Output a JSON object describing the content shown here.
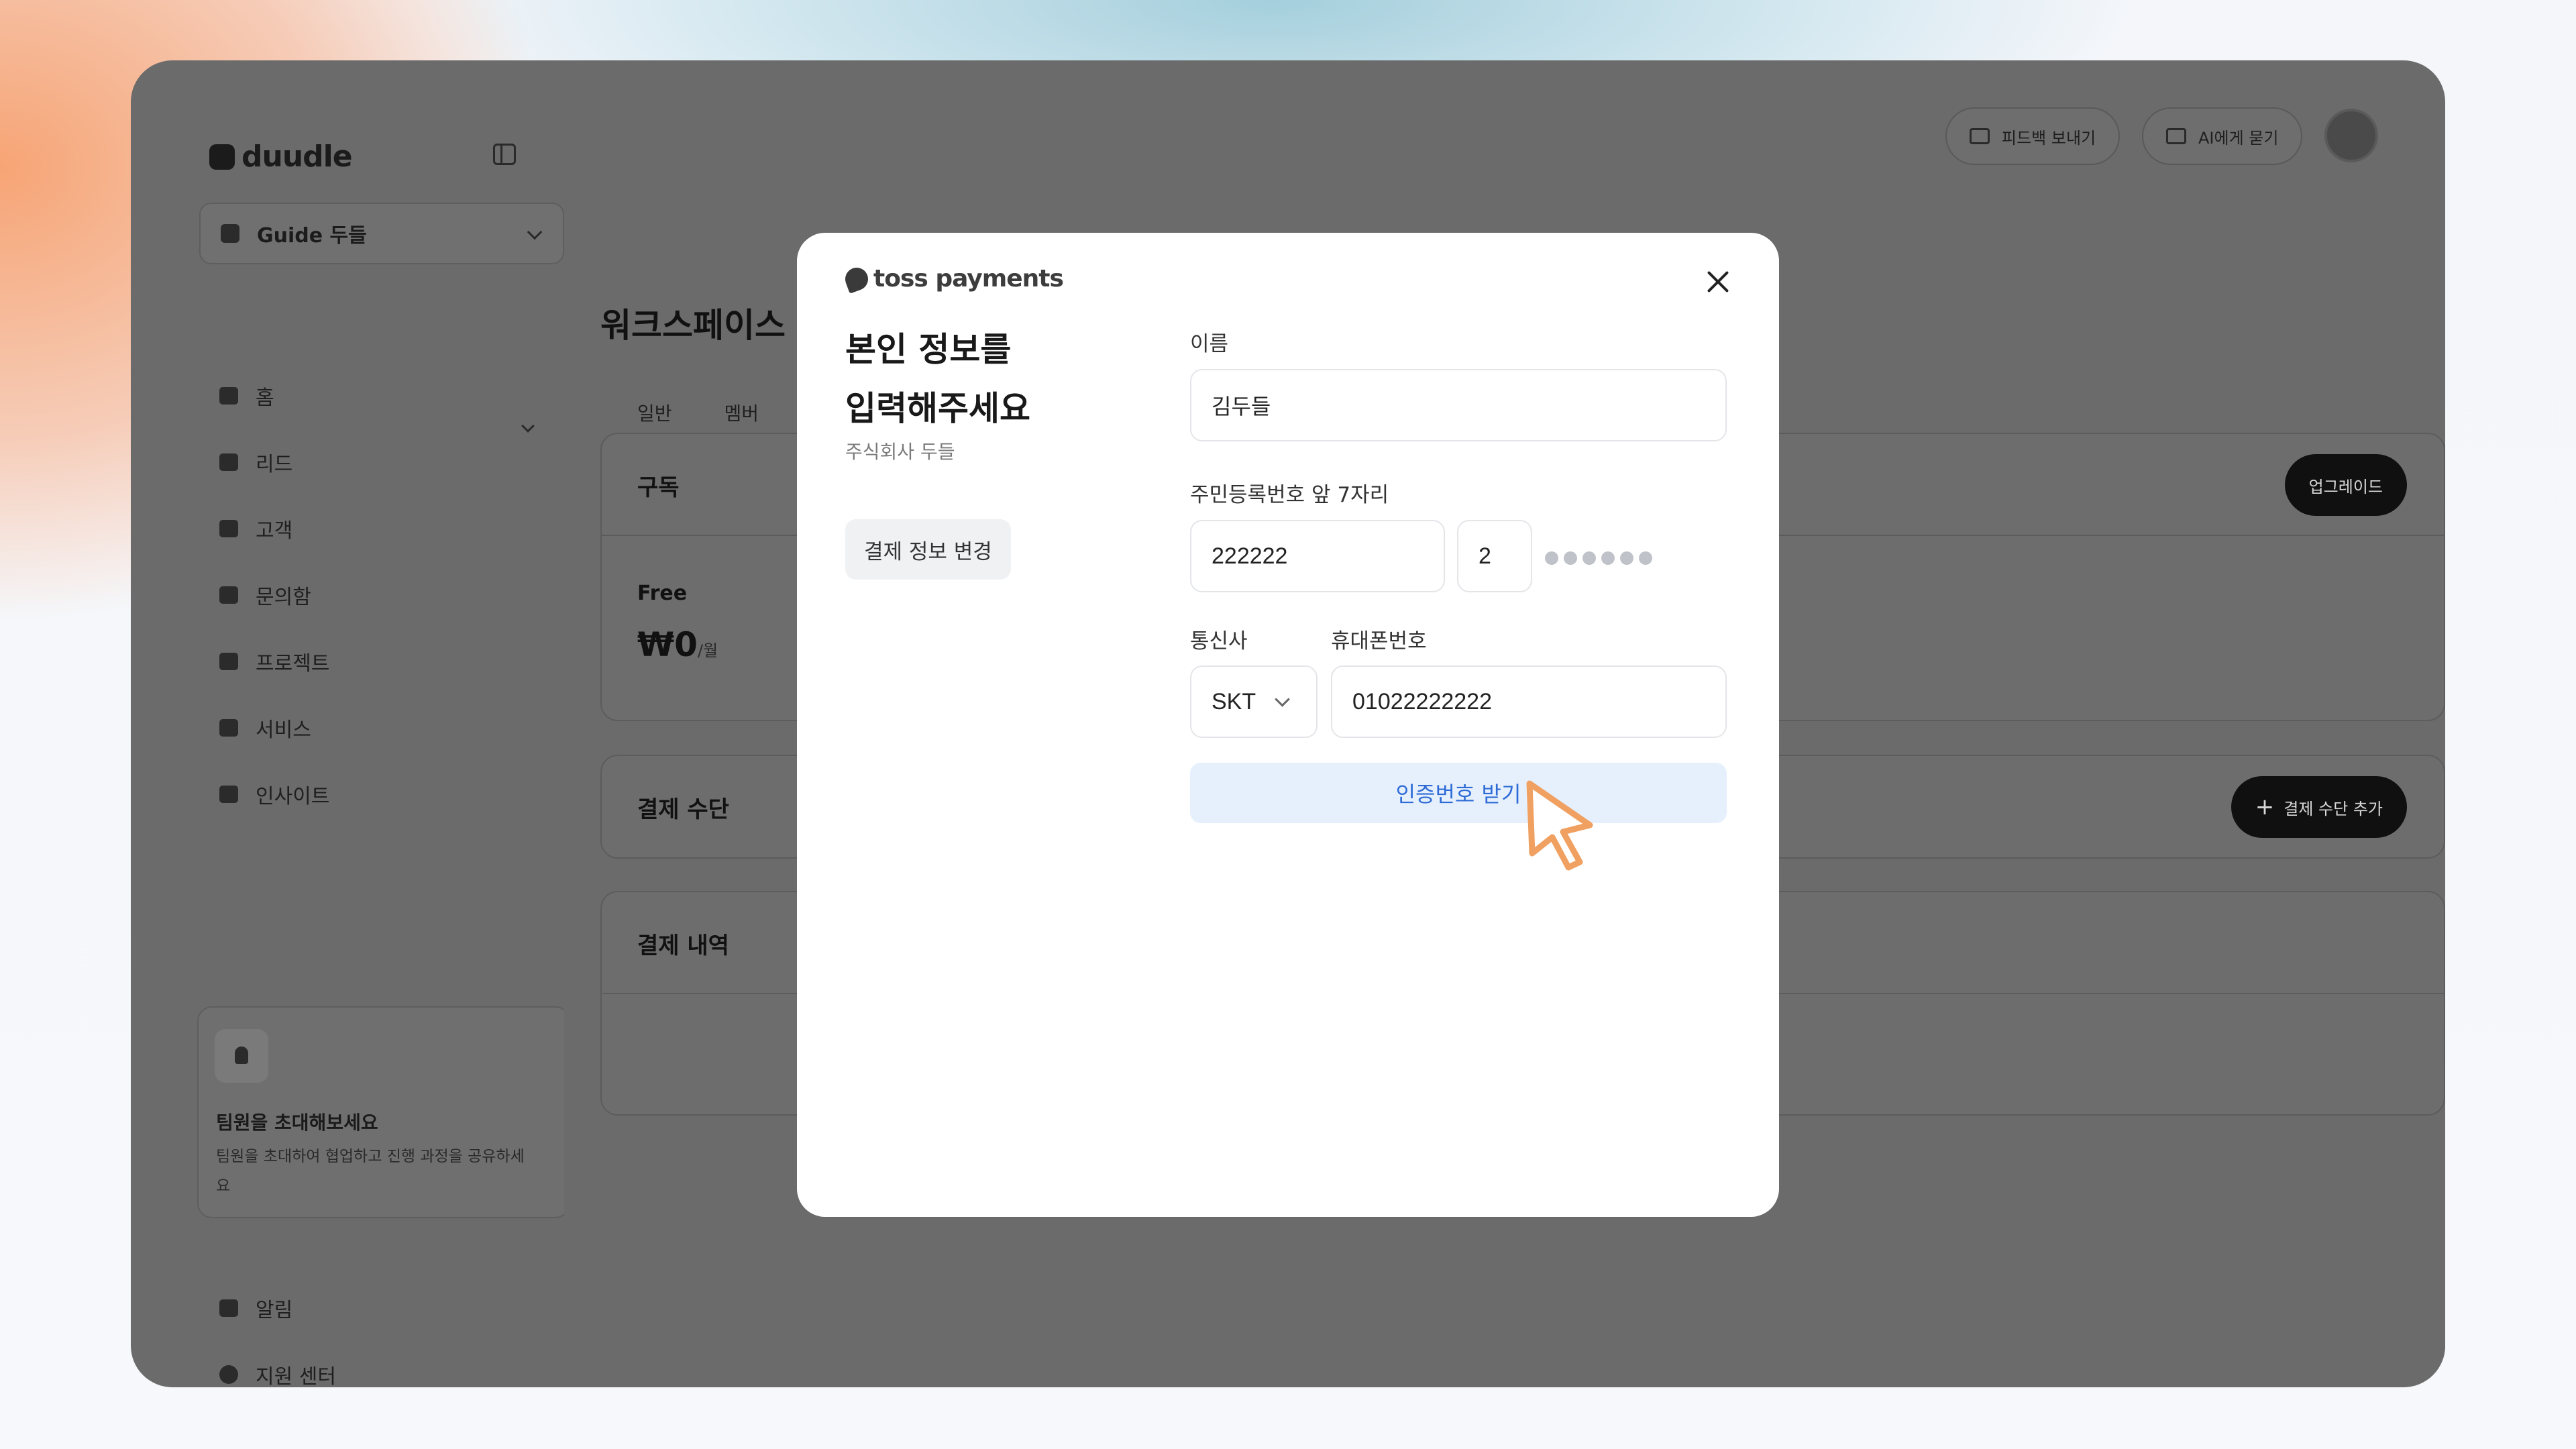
{
  "app": {
    "logo": "duudle",
    "workspace_selector": "Guide 두들"
  },
  "sidebar": {
    "items": [
      {
        "label": "홈",
        "icon": "home-icon"
      },
      {
        "label": "리드",
        "icon": "lead-icon"
      },
      {
        "label": "고객",
        "icon": "user-icon"
      },
      {
        "label": "문의함",
        "icon": "inbox-icon"
      },
      {
        "label": "프로젝트",
        "icon": "folder-icon"
      },
      {
        "label": "서비스",
        "icon": "briefcase-icon"
      },
      {
        "label": "인사이트",
        "icon": "chart-icon"
      }
    ],
    "invite": {
      "title": "팀원을 초대해보세요",
      "description": "팀원을 초대하여 협업하고 진행 과정을 공유하세요"
    },
    "bottom_items": [
      {
        "label": "알림",
        "icon": "bell-icon"
      },
      {
        "label": "지원 센터",
        "icon": "help-icon"
      }
    ]
  },
  "topbar": {
    "feedback": "피드백 보내기",
    "ask_ai": "AI에게 묻기"
  },
  "main": {
    "title": "워크스페이스",
    "tabs": [
      "일반",
      "멤버"
    ],
    "subscription": {
      "title": "구독",
      "plan": "Free",
      "price": "₩0",
      "per": "/월",
      "upgrade": "업그레이드"
    },
    "payment_method": {
      "title": "결제 수단",
      "add": "결제 수단 추가"
    },
    "billing_history": {
      "title": "결제 내역"
    }
  },
  "modal": {
    "brand": "toss payments",
    "heading_line1": "본인 정보를",
    "heading_line2": "입력해주세요",
    "company": "주식회사 두들",
    "change_payment": "결제 정보 변경",
    "name_label": "이름",
    "name_value": "김두들",
    "rrn_label": "주민등록번호 앞 7자리",
    "rrn_front": "222222",
    "rrn_back_first": "2",
    "carrier_label": "통신사",
    "carrier_value": "SKT",
    "phone_label": "휴대폰번호",
    "phone_value": "01022222222",
    "verify_button": "인증번호 받기"
  },
  "colors": {
    "accent_blue": "#2e6bd6",
    "verify_bg": "#e6f0fd",
    "cursor_orange": "#f0a060"
  }
}
